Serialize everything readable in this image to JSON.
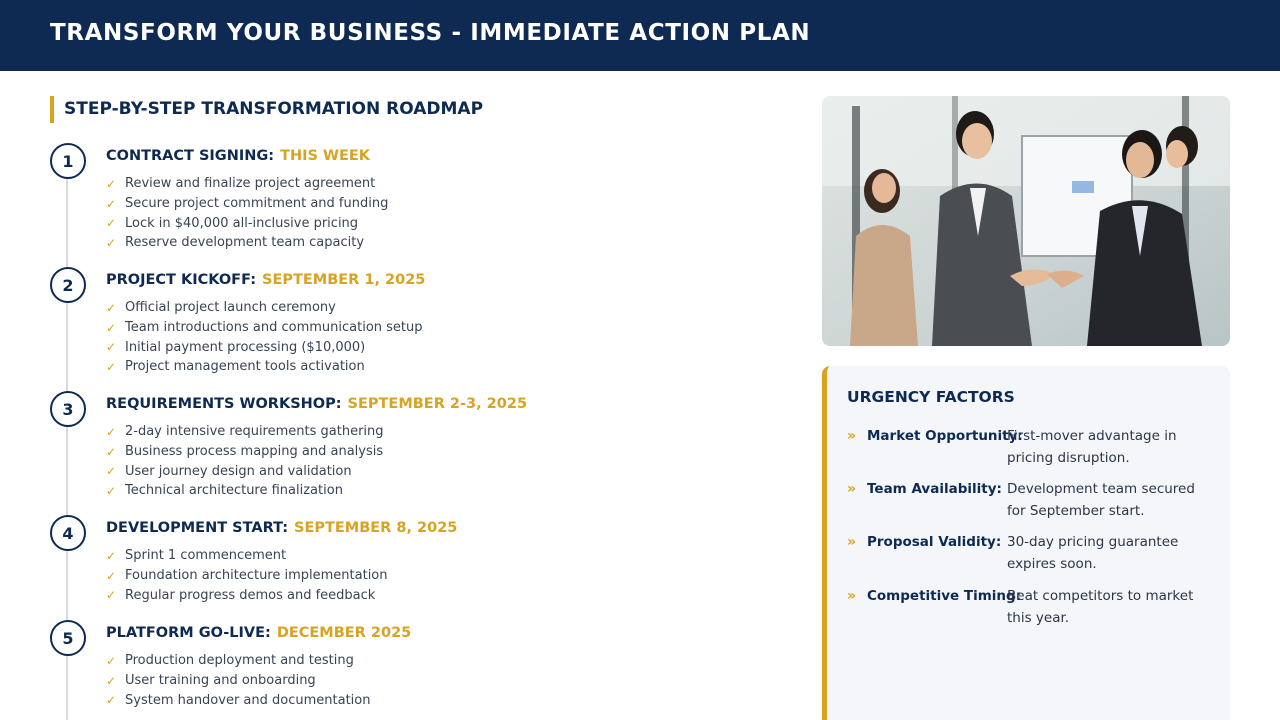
{
  "header": {
    "title": "TRANSFORM YOUR BUSINESS - IMMEDIATE ACTION PLAN"
  },
  "roadmap": {
    "title": "STEP-BY-STEP TRANSFORMATION ROADMAP",
    "check_glyph": "✓",
    "steps": [
      {
        "number": "1",
        "label": "CONTRACT SIGNING:",
        "date": "THIS WEEK",
        "items": [
          "Review and finalize project agreement",
          "Secure project commitment and funding",
          "Lock in $40,000 all-inclusive pricing",
          "Reserve development team capacity"
        ]
      },
      {
        "number": "2",
        "label": "PROJECT KICKOFF:",
        "date": "SEPTEMBER 1, 2025",
        "items": [
          "Official project launch ceremony",
          "Team introductions and communication setup",
          "Initial payment processing ($10,000)",
          "Project management tools activation"
        ]
      },
      {
        "number": "3",
        "label": "REQUIREMENTS WORKSHOP:",
        "date": "SEPTEMBER 2-3, 2025",
        "items": [
          "2-day intensive requirements gathering",
          "Business process mapping and analysis",
          "User journey design and validation",
          "Technical architecture finalization"
        ]
      },
      {
        "number": "4",
        "label": "DEVELOPMENT START:",
        "date": "SEPTEMBER 8, 2025",
        "items": [
          "Sprint 1 commencement",
          "Foundation architecture implementation",
          "Regular progress demos and feedback"
        ]
      },
      {
        "number": "5",
        "label": "PLATFORM GO-LIVE:",
        "date": "DECEMBER 2025",
        "items": [
          "Production deployment and testing",
          "User training and onboarding",
          "System handover and documentation"
        ]
      }
    ]
  },
  "urgency": {
    "title": "URGENCY FACTORS",
    "bullet_glyph": "»",
    "factors": [
      {
        "label": "Market Opportunity:",
        "text": "First-mover advantage in pricing disruption."
      },
      {
        "label": "Team Availability:",
        "text": "Development team secured for September start."
      },
      {
        "label": "Proposal Validity:",
        "text": "30-day pricing guarantee expires soon."
      },
      {
        "label": "Competitive Timing:",
        "text": "Beat competitors to market this year."
      }
    ]
  },
  "colors": {
    "navy": "#0e2a52",
    "gold": "#d9a322",
    "panel": "#f4f6f9"
  },
  "photo": {
    "icon": "business-handshake-photo"
  }
}
